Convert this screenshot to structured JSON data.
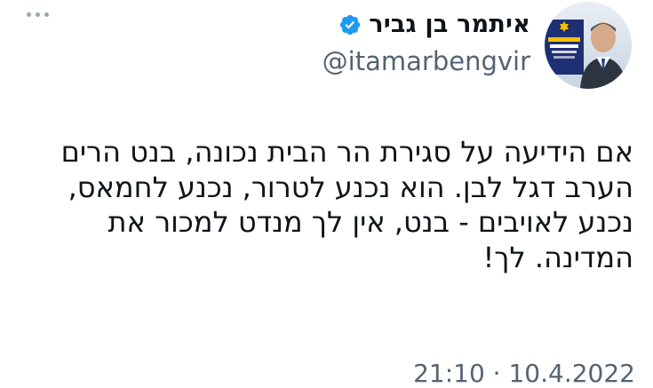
{
  "author": {
    "display_name": "איתמר בן גביר",
    "handle": "@itamarbengvir",
    "avatar_badge_text": "עוצמה יהודית"
  },
  "tweet": {
    "lines": [
      "אם הידיעה על סגירת הר הבית נכונה, בנט הרים",
      "הערב דגל לבן. הוא נכנע לטרור, נכנע לחמאס,",
      "נכנע לאויבים - בנט, אין לך מנדט למכור את",
      "המדינה. לך!"
    ],
    "timestamp": "21:10 · 10.4.2022"
  },
  "colors": {
    "verified_blue": "#1d9bf0",
    "handle_gray": "#536471",
    "text": "#0f1419"
  },
  "icons": {
    "more": "three-dots-icon",
    "verified": "verified-badge-icon"
  }
}
